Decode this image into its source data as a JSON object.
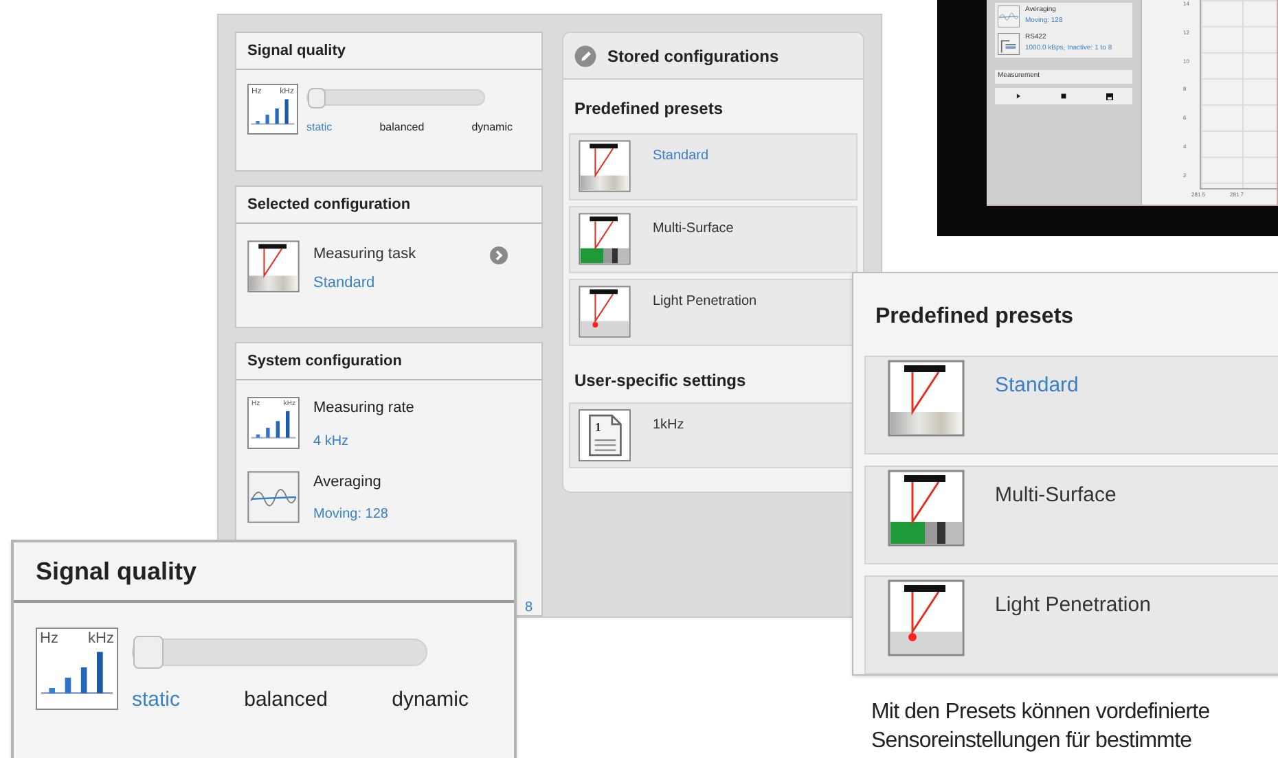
{
  "main_window": {
    "signal_quality": {
      "title": "Signal quality",
      "icon_labels": [
        "Hz",
        "kHz"
      ],
      "level": 0,
      "modes": [
        {
          "label": "static",
          "selected": true
        },
        {
          "label": "balanced",
          "selected": false
        },
        {
          "label": "dynamic",
          "selected": false
        }
      ]
    },
    "selected_configuration": {
      "title": "Selected configuration",
      "label": "Measuring task",
      "value": "Standard"
    },
    "system_configuration": {
      "title": "System configuration",
      "items": [
        {
          "kind": "rate",
          "icon_labels": [
            "Hz",
            "kHz"
          ],
          "label": "Measuring rate",
          "value": "4 kHz"
        },
        {
          "kind": "averaging",
          "label": "Averaging",
          "value": "Moving: 128"
        }
      ],
      "cut_value": "8"
    },
    "stored_configurations": {
      "title": "Stored configurations",
      "predefined": {
        "title": "Predefined presets",
        "presets": [
          {
            "kind": "standard",
            "label": "Standard",
            "selected": true
          },
          {
            "kind": "multi",
            "label": "Multi-Surface",
            "selected": false
          },
          {
            "kind": "light",
            "label": "Light Penetration",
            "selected": false
          }
        ]
      },
      "user_specific": {
        "title": "User-specific settings",
        "items": [
          {
            "icon_label": "1",
            "label": "1kHz"
          }
        ]
      }
    }
  },
  "monitor": {
    "items": [
      {
        "kind": "averaging",
        "label": "Averaging",
        "value": "Moving: 128"
      },
      {
        "kind": "rs422",
        "label": "RS422",
        "value": "1000.0 kBps, Inactive: 1 to 8"
      }
    ],
    "measurement_title": "Measurement",
    "chart_yticks": [
      "14",
      "12",
      "10",
      "8",
      "6",
      "4",
      "2"
    ],
    "chart_xticks": [
      "281.5",
      "281.7"
    ]
  },
  "presets_callout": {
    "title": "Predefined presets",
    "presets": [
      {
        "kind": "standard",
        "label": "Standard",
        "selected": true
      },
      {
        "kind": "multi",
        "label": "Multi-Surface",
        "selected": false
      },
      {
        "kind": "light",
        "label": "Light Penetration",
        "selected": false
      }
    ]
  },
  "caption": "Mit den Presets können vordefinierte Sensoreinstellungen für bestimmte",
  "signal_quality_callout": {
    "title": "Signal quality",
    "icon_labels": [
      "Hz",
      "kHz"
    ],
    "level": 0,
    "modes": [
      {
        "label": "static",
        "selected": true
      },
      {
        "label": "balanced",
        "selected": false
      },
      {
        "label": "dynamic",
        "selected": false
      }
    ]
  }
}
